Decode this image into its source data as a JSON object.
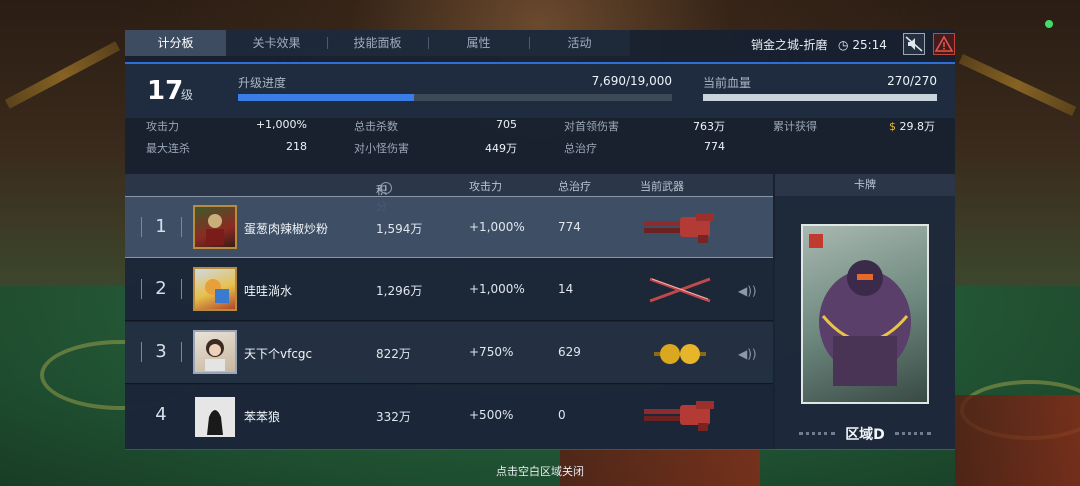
{
  "tabs": [
    {
      "label": "计分板",
      "active": true
    },
    {
      "label": "关卡效果",
      "active": false
    },
    {
      "label": "技能面板",
      "active": false
    },
    {
      "label": "属性",
      "active": false
    },
    {
      "label": "活动",
      "active": false
    }
  ],
  "hud": {
    "mode_name": "销金之城-折磨",
    "timer": "25:14",
    "mute_icon": "speaker-muted-icon",
    "warning_icon": "warning-icon"
  },
  "header": {
    "level": "17",
    "level_unit": "级",
    "progress_label": "升级进度",
    "progress_value": "7,690/19,000",
    "progress_fraction": 0.405,
    "hp_label": "当前血量",
    "hp_value": "270/270",
    "hp_fraction": 1.0
  },
  "stats": {
    "attack_label": "攻击力",
    "attack_value": "+1,000%",
    "kills_label": "总击杀数",
    "kills_value": "705",
    "boss_dmg_label": "对首领伤害",
    "boss_dmg_value": "763万",
    "earned_label": "累计获得",
    "earned_value": "29.8万",
    "combo_label": "最大连杀",
    "combo_value": "218",
    "minion_dmg_label": "对小怪伤害",
    "minion_dmg_value": "449万",
    "heal_label": "总治疗",
    "heal_value": "774"
  },
  "table": {
    "headers": {
      "score": "积分",
      "attack": "攻击力",
      "heal": "总治疗",
      "weapon": "当前武器",
      "card": "卡牌"
    },
    "rows": [
      {
        "rank": "1",
        "name": "蛋葱肉辣椒炒粉",
        "score": "1,594万",
        "attack": "+1,000%",
        "heal": "774",
        "weapon": "minigun-icon",
        "self": true
      },
      {
        "rank": "2",
        "name": "哇哇淌水",
        "score": "1,296万",
        "attack": "+1,000%",
        "heal": "14",
        "weapon": "crossed-blades-icon",
        "self": false
      },
      {
        "rank": "3",
        "name": "天下个vfcgc",
        "score": "822万",
        "attack": "+750%",
        "heal": "629",
        "weapon": "bomb-icon",
        "self": false
      },
      {
        "rank": "4",
        "name": "苯苯狼",
        "score": "332万",
        "attack": "+500%",
        "heal": "0",
        "weapon": "minigun-icon",
        "self": false
      }
    ]
  },
  "card": {
    "label": "区域D"
  },
  "hint": "点击空白区域关闭",
  "colors": {
    "accent": "#2d6ed8",
    "progress": "#3b7de6",
    "hp": "#c9d3dc",
    "coin": "#e5b636"
  }
}
